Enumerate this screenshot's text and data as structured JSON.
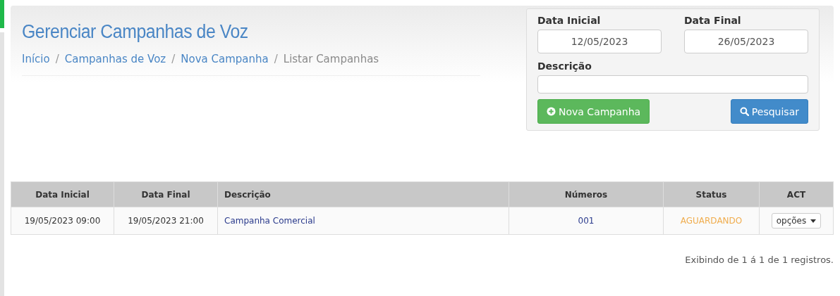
{
  "header": {
    "title": "Gerenciar Campanhas de Voz",
    "breadcrumb": [
      {
        "label": "Início",
        "current": false
      },
      {
        "label": "Campanhas de Voz",
        "current": false
      },
      {
        "label": "Nova Campanha",
        "current": false
      },
      {
        "label": "Listar Campanhas",
        "current": true
      }
    ],
    "separator": "/"
  },
  "filter": {
    "start_label": "Data Inicial",
    "start_value": "12/05/2023",
    "end_label": "Data Final",
    "end_value": "26/05/2023",
    "description_label": "Descrição",
    "new_button": "Nova Campanha",
    "search_button": "Pesquisar"
  },
  "table": {
    "columns": [
      "Data Inicial",
      "Data Final",
      "Descrição",
      "Números",
      "Status",
      "ACT"
    ],
    "rows": [
      {
        "start": "19/05/2023 09:00",
        "end": "19/05/2023 21:00",
        "description": "Campanha Comercial",
        "numbers": "001",
        "status": "AGUARDANDO",
        "color": "#f0ad4e",
        "action": "opções"
      }
    ]
  },
  "footer": "Exibindo de 1 á 1 de 1 registros."
}
